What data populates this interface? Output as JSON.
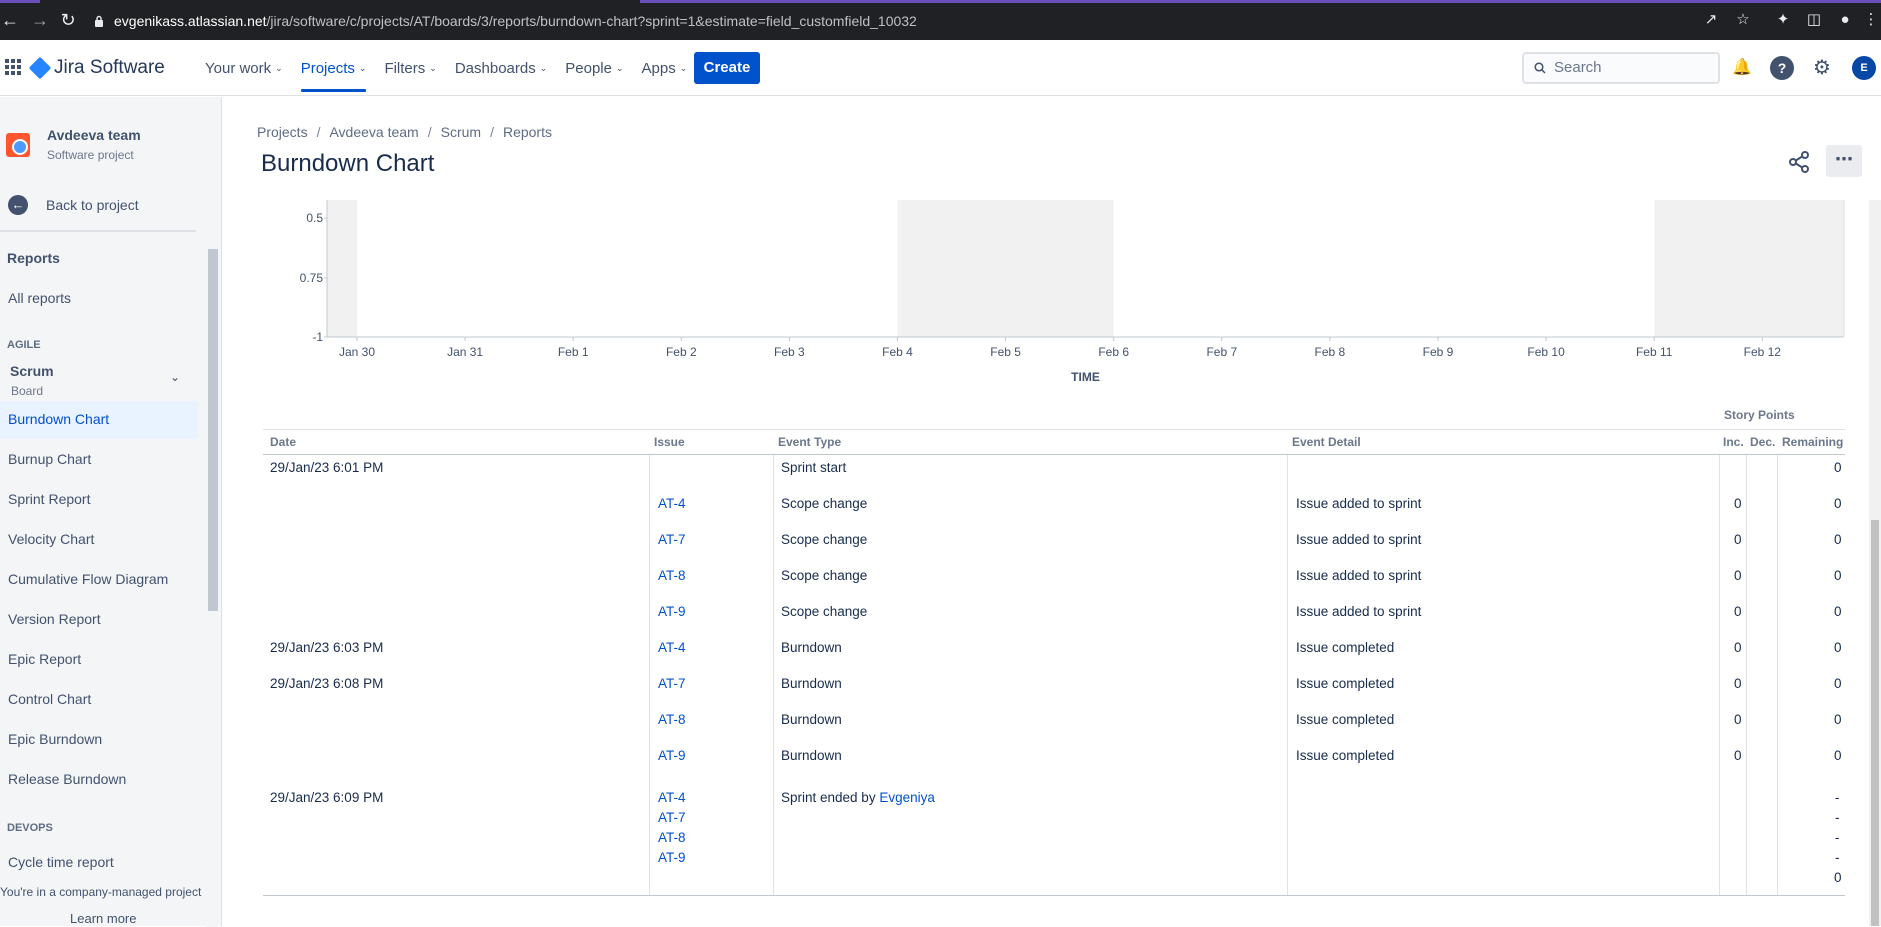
{
  "browser": {
    "url_host": "evgenikass.atlassian.net",
    "url_path": "/jira/software/c/projects/AT/boards/3/reports/burndown-chart?sprint=1&estimate=field_customfield_10032"
  },
  "topnav": {
    "product": "Jira Software",
    "menu": [
      {
        "label": "Your work"
      },
      {
        "label": "Projects"
      },
      {
        "label": "Filters"
      },
      {
        "label": "Dashboards"
      },
      {
        "label": "People"
      },
      {
        "label": "Apps"
      }
    ],
    "create_label": "Create",
    "search_placeholder": "Search",
    "avatar_initial": "E"
  },
  "sidebar": {
    "project_name": "Avdeeva team",
    "project_type": "Software project",
    "back_label": "Back to project",
    "reports_heading": "Reports",
    "all_reports": "All reports",
    "agile_section": "AGILE",
    "board_name": "Scrum",
    "board_sub": "Board",
    "items": [
      {
        "label": "Burndown Chart"
      },
      {
        "label": "Burnup Chart"
      },
      {
        "label": "Sprint Report"
      },
      {
        "label": "Velocity Chart"
      },
      {
        "label": "Cumulative Flow Diagram"
      },
      {
        "label": "Version Report"
      },
      {
        "label": "Epic Report"
      },
      {
        "label": "Control Chart"
      },
      {
        "label": "Epic Burndown"
      },
      {
        "label": "Release Burndown"
      }
    ],
    "devops_section": "DEVOPS",
    "devops_items": [
      {
        "label": "Cycle time report"
      }
    ],
    "footer_text": "You're in a company-managed project",
    "learn_more": "Learn more"
  },
  "breadcrumb": [
    "Projects",
    "Avdeeva team",
    "Scrum",
    "Reports"
  ],
  "page_title": "Burndown Chart",
  "chart_data": {
    "type": "area",
    "x": [
      "Jan 30",
      "Jan 31",
      "Feb 1",
      "Feb 2",
      "Feb 3",
      "Feb 4",
      "Feb 5",
      "Feb 6",
      "Feb 7",
      "Feb 8",
      "Feb 9",
      "Feb 10",
      "Feb 11",
      "Feb 12"
    ],
    "y_ticks": [
      "0.5",
      "0.75",
      "-1"
    ],
    "xlabel": "TIME",
    "ylabel": "",
    "non_working_ranges": [
      [
        "Jan 30",
        "Jan 30"
      ],
      [
        "Feb 4",
        "Feb 6"
      ],
      [
        "Feb 11",
        "Feb 12"
      ]
    ]
  },
  "table": {
    "story_points_header": "Story Points",
    "columns": {
      "date": "Date",
      "issue": "Issue",
      "event_type": "Event Type",
      "event_detail": "Event Detail",
      "inc": "Inc.",
      "dec": "Dec.",
      "remaining": "Remaining"
    },
    "rows": [
      {
        "date": "29/Jan/23 6:01 PM",
        "issue": "",
        "event": "Sprint start",
        "detail": "",
        "inc": "",
        "remaining": "0"
      },
      {
        "date": "",
        "issue": "AT-4",
        "event": "Scope change",
        "detail": "Issue added to sprint",
        "inc": "0",
        "remaining": "0"
      },
      {
        "date": "",
        "issue": "AT-7",
        "event": "Scope change",
        "detail": "Issue added to sprint",
        "inc": "0",
        "remaining": "0"
      },
      {
        "date": "",
        "issue": "AT-8",
        "event": "Scope change",
        "detail": "Issue added to sprint",
        "inc": "0",
        "remaining": "0"
      },
      {
        "date": "",
        "issue": "AT-9",
        "event": "Scope change",
        "detail": "Issue added to sprint",
        "inc": "0",
        "remaining": "0"
      },
      {
        "date": "29/Jan/23 6:03 PM",
        "issue": "AT-4",
        "event": "Burndown",
        "detail": "Issue completed",
        "inc": "0",
        "remaining": "0"
      },
      {
        "date": "29/Jan/23 6:08 PM",
        "issue": "AT-7",
        "event": "Burndown",
        "detail": "Issue completed",
        "inc": "0",
        "remaining": "0"
      },
      {
        "date": "",
        "issue": "AT-8",
        "event": "Burndown",
        "detail": "Issue completed",
        "inc": "0",
        "remaining": "0"
      },
      {
        "date": "",
        "issue": "AT-9",
        "event": "Burndown",
        "detail": "Issue completed",
        "inc": "0",
        "remaining": "0"
      }
    ],
    "last_row": {
      "date": "29/Jan/23 6:09 PM",
      "issues": [
        "AT-4",
        "AT-7",
        "AT-8",
        "AT-9"
      ],
      "event_prefix": "Sprint ended by",
      "event_user": "Evgeniya",
      "remaining": [
        "-",
        "-",
        "-",
        "-",
        "0"
      ]
    }
  }
}
